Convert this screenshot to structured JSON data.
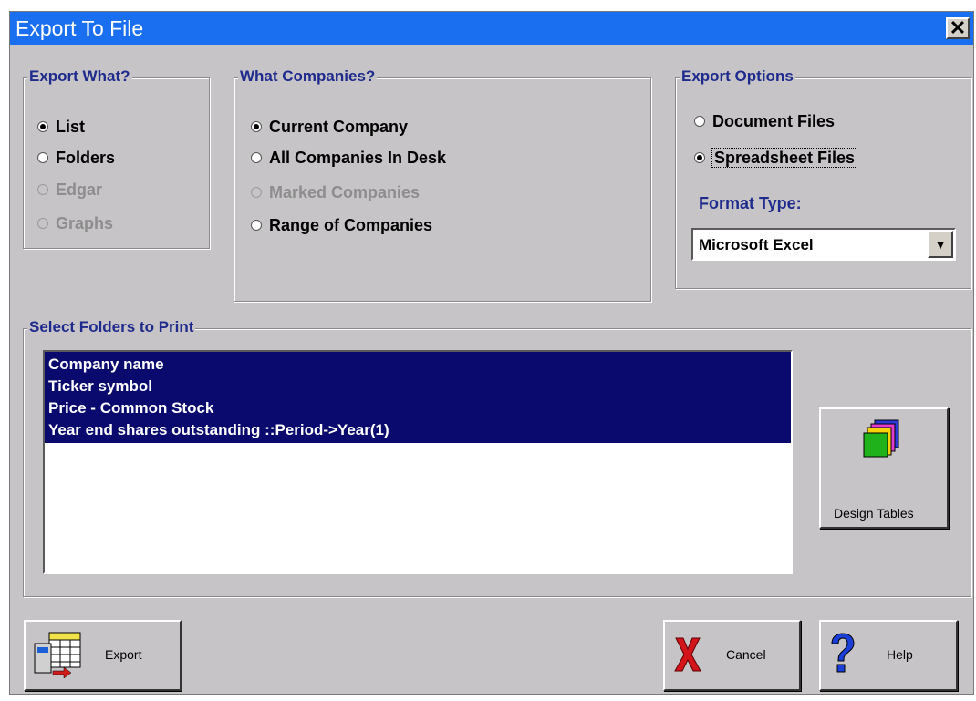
{
  "window": {
    "title": "Export To File",
    "close_glyph": "✕"
  },
  "export_what": {
    "legend": "Export What?",
    "options": [
      {
        "label": "List",
        "selected": true,
        "enabled": true
      },
      {
        "label": "Folders",
        "selected": false,
        "enabled": true
      },
      {
        "label": "Edgar",
        "selected": false,
        "enabled": false
      },
      {
        "label": "Graphs",
        "selected": false,
        "enabled": false
      }
    ]
  },
  "what_companies": {
    "legend": "What Companies?",
    "options": [
      {
        "label": "Current Company",
        "selected": true,
        "enabled": true
      },
      {
        "label": "All Companies In Desk",
        "selected": false,
        "enabled": true
      },
      {
        "label": "Marked Companies",
        "selected": false,
        "enabled": false
      },
      {
        "label": "Range of Companies",
        "selected": false,
        "enabled": true
      }
    ]
  },
  "export_options": {
    "legend": "Export Options",
    "options": [
      {
        "label": "Document Files",
        "selected": false,
        "enabled": true
      },
      {
        "label": "Spreadsheet Files",
        "selected": true,
        "enabled": true
      }
    ],
    "format_label": "Format Type:",
    "format_value": "Microsoft Excel"
  },
  "folders": {
    "legend": "Select Folders to Print",
    "items": [
      "Company name",
      "Ticker symbol",
      "Price - Common Stock",
      "Year end shares outstanding ::Period->Year(1)"
    ]
  },
  "buttons": {
    "design_tables": "Design Tables",
    "export": "Export",
    "cancel": "Cancel",
    "help": "Help"
  },
  "icons": {
    "design_tables": "folders-stack-icon",
    "export": "spreadsheet-export-icon",
    "cancel": "red-x-icon",
    "help": "question-mark-icon"
  }
}
